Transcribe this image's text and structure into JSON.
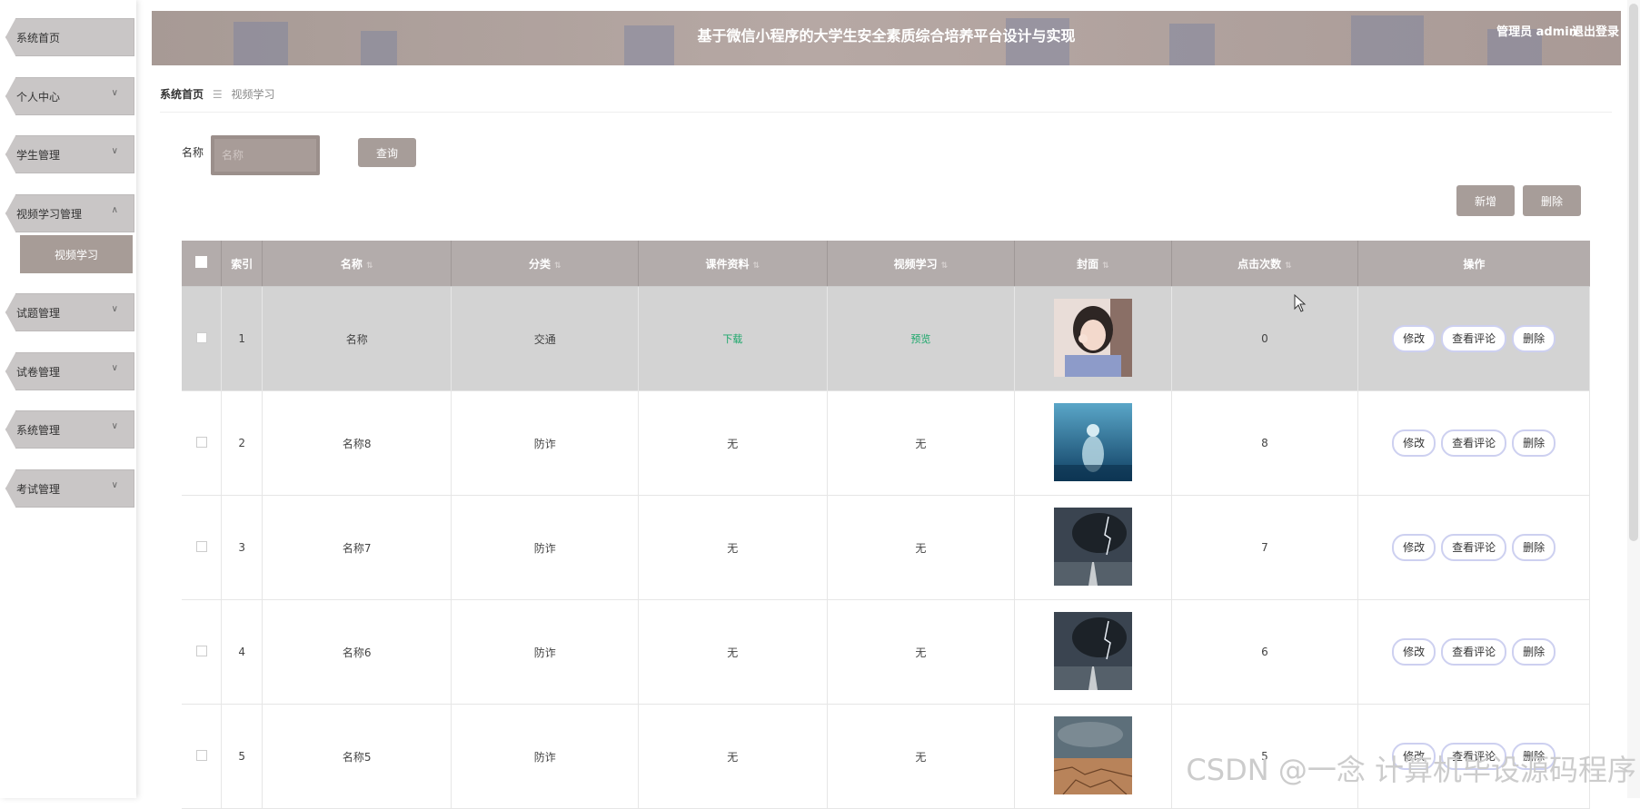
{
  "sidebar": {
    "items": [
      {
        "label": "系统首页",
        "chevron": ""
      },
      {
        "label": "个人中心",
        "chevron": "∨"
      },
      {
        "label": "学生管理",
        "chevron": "∨"
      },
      {
        "label": "视频学习管理",
        "chevron": "∧"
      },
      {
        "label": "试题管理",
        "chevron": "∨"
      },
      {
        "label": "试卷管理",
        "chevron": "∨"
      },
      {
        "label": "系统管理",
        "chevron": "∨"
      },
      {
        "label": "考试管理",
        "chevron": "∨"
      }
    ],
    "active_sub": "视频学习"
  },
  "header": {
    "title": "基于微信小程序的大学生安全素质综合培养平台设计与实现",
    "user": "管理员 admin",
    "logout": "退出登录"
  },
  "breadcrumb": {
    "home": "系统首页",
    "sep": "☰",
    "current": "视频学习"
  },
  "search": {
    "label": "名称",
    "placeholder": "名称",
    "value": "",
    "button": "查询"
  },
  "actions": {
    "add": "新增",
    "delete": "删除"
  },
  "table": {
    "headers": [
      "索引",
      "名称",
      "分类",
      "课件资料",
      "视频学习",
      "封面",
      "点击次数",
      "操作"
    ],
    "sort_icon": "⇅",
    "rows": [
      {
        "index": "1",
        "name": "名称",
        "category": "交通",
        "material": "下载",
        "video": "预览",
        "cover": "portrait-girl-image",
        "clicks": "0"
      },
      {
        "index": "2",
        "name": "名称8",
        "category": "防诈",
        "material": "无",
        "video": "无",
        "cover": "ocean-figure-image",
        "clicks": "8"
      },
      {
        "index": "3",
        "name": "名称7",
        "category": "防诈",
        "material": "无",
        "video": "无",
        "cover": "storm-road-image",
        "clicks": "7"
      },
      {
        "index": "4",
        "name": "名称6",
        "category": "防诈",
        "material": "无",
        "video": "无",
        "cover": "storm-road-image",
        "clicks": "6"
      },
      {
        "index": "5",
        "name": "名称5",
        "category": "防诈",
        "material": "无",
        "video": "无",
        "cover": "cracked-earth-image",
        "clicks": "5"
      }
    ],
    "ops": {
      "edit": "修改",
      "comments": "查看评论",
      "delete": "删除"
    }
  },
  "watermark": "CSDN @一念 计算机毕设源码程序",
  "colors": {
    "primary": "#a79d99",
    "header_bg": "#b3acab",
    "highlight_row": "#d3d3d3",
    "link_green": "#1aa76a"
  }
}
